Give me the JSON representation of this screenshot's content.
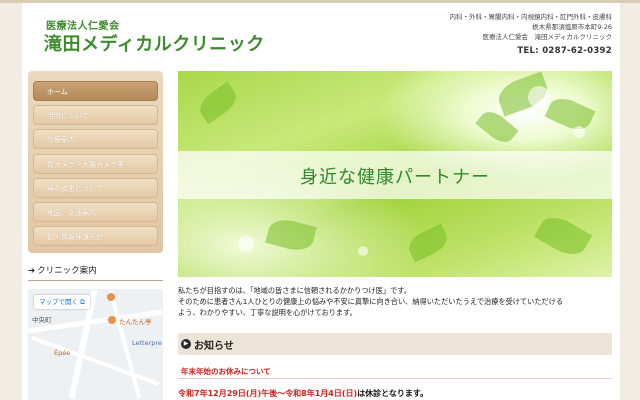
{
  "header": {
    "corp_name": "医療法人仁愛会",
    "clinic_name": "滝田メディカルクリニック",
    "departments": "内科・外科・胃腸内科・内視鏡内科・肛門外科・皮膚科",
    "address": "栃木県那須塩原市本町9-26",
    "corp_clinic": "医療法人仁愛会　滝田メディカルクリニック",
    "tel": "TEL: 0287-62-0392"
  },
  "nav": {
    "items": [
      {
        "label": "ホーム",
        "active": true
      },
      {
        "label": "当院について"
      },
      {
        "label": "診療案内"
      },
      {
        "label": "胃カメラ・大腸カメラ等"
      },
      {
        "label": "痔の疾患について"
      },
      {
        "label": "地図、交通案内"
      },
      {
        "label": "個人情報保護方針"
      }
    ]
  },
  "map_section": {
    "title": "クリニック案内",
    "open_map_label": "マップで開く",
    "labels": [
      "中央町",
      "たんたん亭",
      "Épée",
      "Letterpre"
    ]
  },
  "hero": {
    "tagline": "身近な健康パートナー"
  },
  "intro": {
    "line1": "私たちが目指すのは、「地域の皆さまに信頼されるかかりつけ医」です。",
    "line2": "そのために患者さん1人ひとりの健康上の悩みや不安に真摯に向き合い、納得いただいたうえで治療を受けていただける",
    "line3": "よう、わかりやすい、丁寧な説明を心がけております。"
  },
  "news": {
    "heading": "お知らせ",
    "item_title": "年末年始のお休みについて",
    "item_red": "令和7年12月29日(月)午後～令和8年1月4日(日)",
    "item_rest": "は休診となります。"
  },
  "colors": {
    "brand_green": "#3c8b2a",
    "nav_tan": "#e3c9a5",
    "nav_active": "#b3895a",
    "alert_red": "#d0201c"
  },
  "icons": [
    "arrow-right-icon",
    "external-link-icon",
    "info-dot-icon",
    "map-pin-icon"
  ]
}
